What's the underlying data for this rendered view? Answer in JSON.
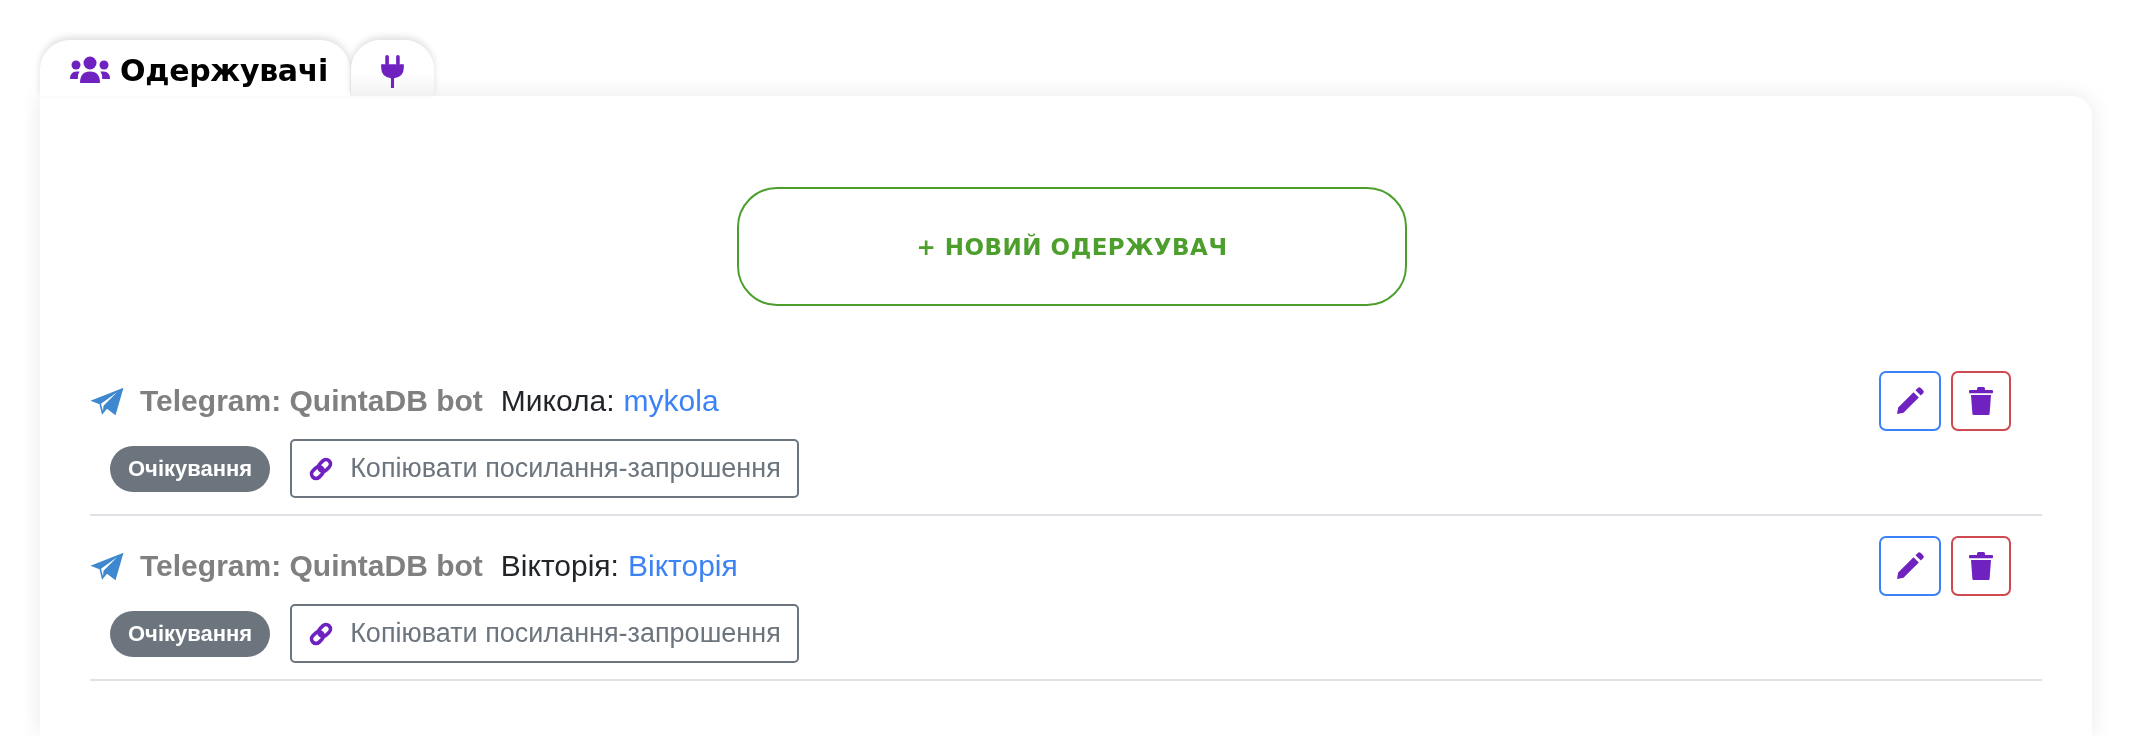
{
  "tabs": [
    {
      "label": "Одержувачі",
      "selected": true
    },
    {
      "selected": false
    }
  ],
  "add_button": {
    "label": "+ НОВИЙ ОДЕРЖУВАЧ"
  },
  "recipients": [
    {
      "channel": "Telegram: QuintaDB bot",
      "name": "Микола:",
      "username": "mykola",
      "status": "Очікування",
      "invite_button": "Копіювати посилання-запрошення"
    },
    {
      "channel": "Telegram: QuintaDB bot",
      "name": "Вікторія:",
      "username": "Вікторія",
      "status": "Очікування",
      "invite_button": "Копіювати посилання-запрошення"
    }
  ]
}
